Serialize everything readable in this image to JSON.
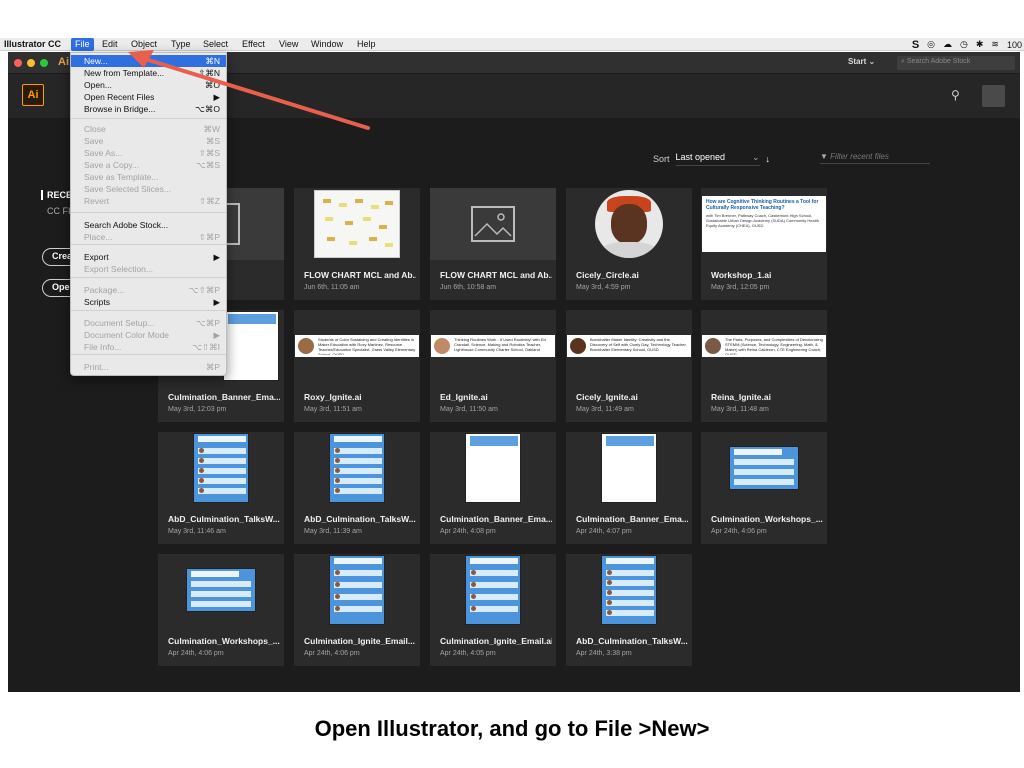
{
  "menubar": {
    "app_name": "Illustrator CC",
    "items": [
      "File",
      "Edit",
      "Object",
      "Type",
      "Select",
      "Effect",
      "View",
      "Window",
      "Help"
    ],
    "battery": "100"
  },
  "window": {
    "app_fragment": "Ai",
    "start_label": "Start",
    "search_placeholder": "Search Adobe Stock",
    "logo": "Ai"
  },
  "sidebar": {
    "section_label": "RECENT",
    "sub_label": "CC FILES",
    "create_label": "Create New...",
    "open_label": "Open..."
  },
  "sort": {
    "label": "Sort",
    "value": "Last opened",
    "filter_placeholder": "Filter recent files"
  },
  "files": [
    {
      "name": "",
      "date": ""
    },
    {
      "name": "FLOW CHART MCL and Ab...",
      "date": "Jun 6th, 11:05 am"
    },
    {
      "name": "FLOW CHART MCL and Ab...",
      "date": "Jun 6th, 10:58 am"
    },
    {
      "name": "Cicely_Circle.ai",
      "date": "May 3rd, 4:59 pm"
    },
    {
      "name": "Workshop_1.ai",
      "date": "May 3rd, 12:05 pm"
    },
    {
      "name": "Culmination_Banner_Ema...",
      "date": "May 3rd, 12:03 pm"
    },
    {
      "name": "Roxy_Ignite.ai",
      "date": "May 3rd, 11:51 am"
    },
    {
      "name": "Ed_Ignite.ai",
      "date": "May 3rd, 11:50 am"
    },
    {
      "name": "Cicely_Ignite.ai",
      "date": "May 3rd, 11:49 am"
    },
    {
      "name": "Reina_Ignite.ai",
      "date": "May 3rd, 11:48 am"
    },
    {
      "name": "AbD_Culmination_TalksW...",
      "date": "May 3rd, 11:46 am"
    },
    {
      "name": "AbD_Culmination_TalksW...",
      "date": "May 3rd, 11:39 am"
    },
    {
      "name": "Culmination_Banner_Ema...",
      "date": "Apr 24th, 4:08 pm"
    },
    {
      "name": "Culmination_Banner_Ema...",
      "date": "Apr 24th, 4:07 pm"
    },
    {
      "name": "Culmination_Workshops_...",
      "date": "Apr 24th, 4:06 pm"
    },
    {
      "name": "Culmination_Workshops_...",
      "date": "Apr 24th, 4:06 pm"
    },
    {
      "name": "Culmination_Ignite_Email...",
      "date": "Apr 24th, 4:06 pm"
    },
    {
      "name": "Culmination_Ignite_Email.ai",
      "date": "Apr 24th, 4:05 pm"
    },
    {
      "name": "AbD_Culmination_TalksW...",
      "date": "Apr 24th, 3:38 pm"
    }
  ],
  "thumbnails": {
    "workshop_title": "How are Cognitive Thinking Routines a Tool for Culturally Responsive Teaching?",
    "workshop_sub": "with Tim Brenner, Pathway Coach, Castlemont High School, Sustainable Urban Design Academy (SUDA) Community Health Equity Academy (CHEA), OUSD",
    "roxy": "Students of Color Sustaining and Creating Identities in Maker Education with Roxy Martinez, Resource Teacher/Education Specialist, Grass Valley Elementary School, OUSD",
    "ed": "Thinking Routines Work - If Used Routinely! with Ed Crandall, Science, Making and Robotics Teacher, Lighthouse Community Charter School, Oakland",
    "cicely": "Burckhalter Maker Identity: Creativity and the Discovery of Self with Cicely Day, Technology Teacher, Burckhalter Elementary School, OUSD",
    "reina": "The Parts, Purposes, and Complexities of Decolonizing STEMM (Science, Technology, Engineering, Math, & Maker) with Reina Calderon, CTE Engineering Coach, OUSD"
  },
  "file_menu": {
    "items": [
      {
        "label": "New...",
        "shortcut": "⌘N",
        "enabled": true,
        "highlight": true
      },
      {
        "label": "New from Template...",
        "shortcut": "⇧⌘N",
        "enabled": true
      },
      {
        "label": "Open...",
        "shortcut": "⌘O",
        "enabled": true
      },
      {
        "label": "Open Recent Files",
        "shortcut": "▶",
        "enabled": true
      },
      {
        "label": "Browse in Bridge...",
        "shortcut": "⌥⌘O",
        "enabled": true
      },
      {
        "label": "Close",
        "shortcut": "⌘W",
        "enabled": false
      },
      {
        "label": "Save",
        "shortcut": "⌘S",
        "enabled": false
      },
      {
        "label": "Save As...",
        "shortcut": "⇧⌘S",
        "enabled": false
      },
      {
        "label": "Save a Copy...",
        "shortcut": "⌥⌘S",
        "enabled": false
      },
      {
        "label": "Save as Template...",
        "shortcut": "",
        "enabled": false
      },
      {
        "label": "Save Selected Slices...",
        "shortcut": "",
        "enabled": false
      },
      {
        "label": "Revert",
        "shortcut": "⇧⌘Z",
        "enabled": false
      },
      {
        "label": "Search Adobe Stock...",
        "shortcut": "",
        "enabled": true
      },
      {
        "label": "Place...",
        "shortcut": "⇧⌘P",
        "enabled": false
      },
      {
        "label": "Export",
        "shortcut": "▶",
        "enabled": true
      },
      {
        "label": "Export Selection...",
        "shortcut": "",
        "enabled": false
      },
      {
        "label": "Package...",
        "shortcut": "⌥⇧⌘P",
        "enabled": false
      },
      {
        "label": "Scripts",
        "shortcut": "▶",
        "enabled": true
      },
      {
        "label": "Document Setup...",
        "shortcut": "⌥⌘P",
        "enabled": false
      },
      {
        "label": "Document Color Mode",
        "shortcut": "▶",
        "enabled": false
      },
      {
        "label": "File Info...",
        "shortcut": "⌥⇧⌘I",
        "enabled": false
      },
      {
        "label": "Print...",
        "shortcut": "⌘P",
        "enabled": false
      }
    ]
  },
  "caption": "Open Illustrator, and go to File >New>",
  "colors": {
    "accent": "#2f6fe0",
    "annotation_arrow": "#e8604c",
    "ai_orange": "#ff9a00"
  }
}
